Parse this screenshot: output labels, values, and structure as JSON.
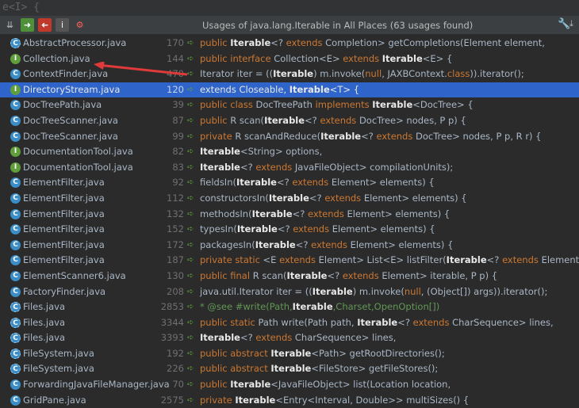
{
  "editor_snippet": "e<I> {",
  "toolbar": {
    "title": "Usages of java.lang.Iterable in All Places (63 usages found)",
    "buttons": [
      {
        "name": "expand-all-icon",
        "glyph": "⇊",
        "color": "#bbbbbb",
        "bg": "transparent"
      },
      {
        "name": "next-occurrence-icon",
        "glyph": "➜",
        "color": "#ffffff",
        "bg": "#4e8f3a"
      },
      {
        "name": "previous-occurrence-icon",
        "glyph": "➜",
        "color": "#ffffff",
        "bg": "#c0392b"
      },
      {
        "name": "info-icon",
        "glyph": "i",
        "color": "#ffffff",
        "bg": "#555555"
      },
      {
        "name": "settings-icon",
        "glyph": "⚙",
        "color": "#ff6060",
        "bg": "transparent"
      }
    ],
    "wrench_icon": "wrench-icon",
    "pin_icon": "pin-icon"
  },
  "rows": [
    {
      "icon": "a",
      "file": "AbstractProcessor.java",
      "line": "170",
      "code": [
        [
          "kw",
          "public "
        ],
        [
          "hl",
          "Iterable"
        ],
        [
          "",
          "<? "
        ],
        [
          "kw",
          "extends "
        ],
        [
          "",
          "Completion> getCompletions(Element element,"
        ]
      ]
    },
    {
      "icon": "i",
      "file": "Collection.java",
      "line": "144",
      "code": [
        [
          "kw",
          "public interface "
        ],
        [
          "",
          "Collection<E> "
        ],
        [
          "kw",
          "extends "
        ],
        [
          "hl",
          "Iterable"
        ],
        [
          "",
          "<E> {"
        ]
      ]
    },
    {
      "icon": "c",
      "file": "ContextFinder.java",
      "line": "470",
      "code": [
        [
          "",
          "Iterator iter = (("
        ],
        [
          "hl",
          "Iterable"
        ],
        [
          "",
          ") m.invoke("
        ],
        [
          "kw",
          "null"
        ],
        [
          "",
          ", JAXBContext."
        ],
        [
          "kw",
          "class"
        ],
        [
          "",
          ")).iterator();"
        ]
      ]
    },
    {
      "icon": "i",
      "file": "DirectoryStream.java",
      "line": "120",
      "selected": true,
      "code": [
        [
          "",
          "extends Closeable, "
        ],
        [
          "hl",
          "Iterable"
        ],
        [
          "",
          "<T> {"
        ]
      ]
    },
    {
      "icon": "c",
      "file": "DocTreePath.java",
      "line": "39",
      "code": [
        [
          "kw",
          "public class "
        ],
        [
          "",
          "DocTreePath "
        ],
        [
          "kw",
          "implements "
        ],
        [
          "hl",
          "Iterable"
        ],
        [
          "",
          "<DocTree> {"
        ]
      ]
    },
    {
      "icon": "c",
      "file": "DocTreeScanner.java",
      "line": "87",
      "code": [
        [
          "kw",
          "public "
        ],
        [
          "",
          "R scan("
        ],
        [
          "hl",
          "Iterable"
        ],
        [
          "",
          "<? "
        ],
        [
          "kw",
          "extends "
        ],
        [
          "",
          "DocTree> nodes, P p) {"
        ]
      ]
    },
    {
      "icon": "c",
      "file": "DocTreeScanner.java",
      "line": "99",
      "code": [
        [
          "kw",
          "private "
        ],
        [
          "",
          "R scanAndReduce("
        ],
        [
          "hl",
          "Iterable"
        ],
        [
          "",
          "<? "
        ],
        [
          "kw",
          "extends "
        ],
        [
          "",
          "DocTree> nodes, P p, R r) {"
        ]
      ]
    },
    {
      "icon": "i",
      "file": "DocumentationTool.java",
      "line": "82",
      "code": [
        [
          "hl",
          "Iterable"
        ],
        [
          "",
          "<String> options,"
        ]
      ]
    },
    {
      "icon": "i",
      "file": "DocumentationTool.java",
      "line": "83",
      "code": [
        [
          "hl",
          "Iterable"
        ],
        [
          "",
          "<? "
        ],
        [
          "kw",
          "extends "
        ],
        [
          "",
          "JavaFileObject> compilationUnits);"
        ]
      ]
    },
    {
      "icon": "c",
      "file": "ElementFilter.java",
      "line": "92",
      "code": [
        [
          "",
          "fieldsIn("
        ],
        [
          "hl",
          "Iterable"
        ],
        [
          "",
          "<? "
        ],
        [
          "kw",
          "extends "
        ],
        [
          "",
          "Element> elements) {"
        ]
      ]
    },
    {
      "icon": "c",
      "file": "ElementFilter.java",
      "line": "112",
      "code": [
        [
          "",
          "constructorsIn("
        ],
        [
          "hl",
          "Iterable"
        ],
        [
          "",
          "<? "
        ],
        [
          "kw",
          "extends "
        ],
        [
          "",
          "Element> elements) {"
        ]
      ]
    },
    {
      "icon": "c",
      "file": "ElementFilter.java",
      "line": "132",
      "code": [
        [
          "",
          "methodsIn("
        ],
        [
          "hl",
          "Iterable"
        ],
        [
          "",
          "<? "
        ],
        [
          "kw",
          "extends "
        ],
        [
          "",
          "Element> elements) {"
        ]
      ]
    },
    {
      "icon": "c",
      "file": "ElementFilter.java",
      "line": "152",
      "code": [
        [
          "",
          "typesIn("
        ],
        [
          "hl",
          "Iterable"
        ],
        [
          "",
          "<? "
        ],
        [
          "kw",
          "extends "
        ],
        [
          "",
          "Element> elements) {"
        ]
      ]
    },
    {
      "icon": "c",
      "file": "ElementFilter.java",
      "line": "172",
      "code": [
        [
          "",
          "packagesIn("
        ],
        [
          "hl",
          "Iterable"
        ],
        [
          "",
          "<? "
        ],
        [
          "kw",
          "extends "
        ],
        [
          "",
          "Element> elements) {"
        ]
      ]
    },
    {
      "icon": "c",
      "file": "ElementFilter.java",
      "line": "187",
      "code": [
        [
          "kw",
          "private static "
        ],
        [
          "",
          "<E "
        ],
        [
          "kw",
          "extends "
        ],
        [
          "",
          "Element> List<E> listFilter("
        ],
        [
          "hl",
          "Iterable"
        ],
        [
          "",
          "<? "
        ],
        [
          "kw",
          "extends "
        ],
        [
          "",
          "Element> elements,"
        ]
      ]
    },
    {
      "icon": "c",
      "file": "ElementScanner6.java",
      "line": "130",
      "code": [
        [
          "kw",
          "public final "
        ],
        [
          "",
          "R scan("
        ],
        [
          "hl",
          "Iterable"
        ],
        [
          "",
          "<? "
        ],
        [
          "kw",
          "extends "
        ],
        [
          "",
          "Element> iterable, P p) {"
        ]
      ]
    },
    {
      "icon": "c",
      "file": "FactoryFinder.java",
      "line": "208",
      "code": [
        [
          "",
          "java.util.Iterator iter = (("
        ],
        [
          "hl",
          "Iterable"
        ],
        [
          "",
          ") m.invoke("
        ],
        [
          "kw",
          "null"
        ],
        [
          "",
          ", (Object[]) args)).iterator();"
        ]
      ]
    },
    {
      "icon": "a",
      "file": "Files.java",
      "line": "2853",
      "code": [
        [
          "cm",
          "* @see #write(Path,"
        ],
        [
          "hl",
          "Iterable"
        ],
        [
          "cm",
          ",Charset,OpenOption[])"
        ]
      ]
    },
    {
      "icon": "a",
      "file": "Files.java",
      "line": "3344",
      "code": [
        [
          "kw",
          "public static "
        ],
        [
          "",
          "Path write(Path path, "
        ],
        [
          "hl",
          "Iterable"
        ],
        [
          "",
          "<? "
        ],
        [
          "kw",
          "extends "
        ],
        [
          "",
          "CharSequence> lines,"
        ]
      ]
    },
    {
      "icon": "a",
      "file": "Files.java",
      "line": "3393",
      "code": [
        [
          "hl",
          "Iterable"
        ],
        [
          "",
          "<? "
        ],
        [
          "kw",
          "extends "
        ],
        [
          "",
          "CharSequence> lines,"
        ]
      ]
    },
    {
      "icon": "a",
      "file": "FileSystem.java",
      "line": "192",
      "code": [
        [
          "kw",
          "public abstract "
        ],
        [
          "hl",
          "Iterable"
        ],
        [
          "",
          "<Path> getRootDirectories();"
        ]
      ]
    },
    {
      "icon": "a",
      "file": "FileSystem.java",
      "line": "226",
      "code": [
        [
          "kw",
          "public abstract "
        ],
        [
          "hl",
          "Iterable"
        ],
        [
          "",
          "<FileStore> getFileStores();"
        ]
      ]
    },
    {
      "icon": "c",
      "file": "ForwardingJavaFileManager.java",
      "line": "70",
      "code": [
        [
          "kw",
          "public "
        ],
        [
          "hl",
          "Iterable"
        ],
        [
          "",
          "<JavaFileObject> list(Location location,"
        ]
      ]
    },
    {
      "icon": "c",
      "file": "GridPane.java",
      "line": "2575",
      "code": [
        [
          "kw",
          "private "
        ],
        [
          "hl",
          "Iterable"
        ],
        [
          "",
          "<Entry<Interval, Double>> multiSizes() {"
        ]
      ]
    }
  ]
}
